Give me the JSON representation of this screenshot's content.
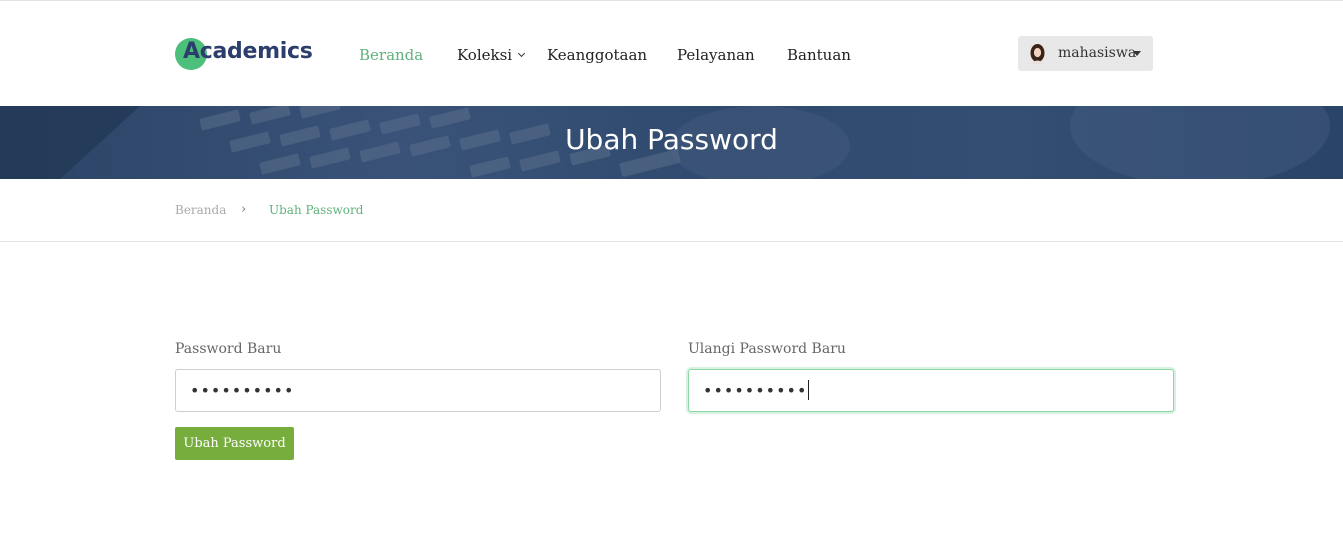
{
  "brand": {
    "name": "Academics",
    "logo_color": "#4cbf7a",
    "text_color": "#2c3e6b"
  },
  "nav": {
    "items": [
      {
        "label": "Beranda",
        "active": true
      },
      {
        "label": "Koleksi",
        "has_dropdown": true
      },
      {
        "label": "Keanggotaan"
      },
      {
        "label": "Pelayanan"
      },
      {
        "label": "Bantuan"
      }
    ],
    "active_color": "#5fb27a"
  },
  "user": {
    "name": "mahasiswa",
    "avatar_icon": "user-avatar-icon"
  },
  "banner": {
    "title": "Ubah Password"
  },
  "breadcrumb": {
    "home": "Beranda",
    "separator": "›",
    "current": "Ubah Password"
  },
  "form": {
    "new_password": {
      "label": "Password Baru",
      "value": "••••••••••"
    },
    "confirm_password": {
      "label": "Ulangi Password Baru",
      "value": "••••••••••",
      "focused": true
    },
    "submit_label": "Ubah Password",
    "submit_color": "#76ad3c"
  }
}
